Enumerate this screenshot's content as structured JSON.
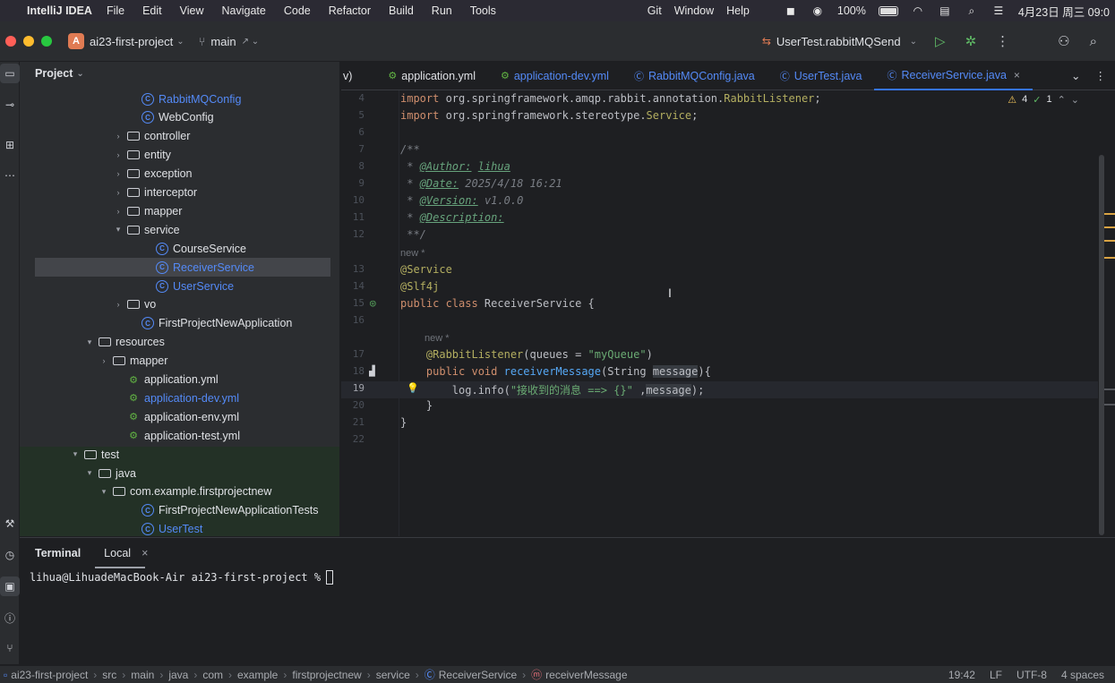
{
  "menubar": {
    "app_name": "IntelliJ IDEA",
    "items": [
      "File",
      "Edit",
      "View",
      "Navigate",
      "Code",
      "Refactor",
      "Build",
      "Run",
      "Tools"
    ],
    "right_items": [
      "Git",
      "Window",
      "Help"
    ],
    "battery": "100%",
    "clock": "4月23日 周三 09:0"
  },
  "titlebar": {
    "project_badge": "A",
    "project_name": "ai23-first-project",
    "branch": "main",
    "run_config": "UserTest.rabbitMQSend"
  },
  "project": {
    "title": "Project",
    "rows": [
      {
        "label": "RabbitMQConfig",
        "type": "class",
        "expandable": false,
        "color": "#548af7"
      },
      {
        "label": "WebConfig",
        "type": "class",
        "expandable": false
      },
      {
        "label": "controller",
        "type": "folder",
        "expandable": true
      },
      {
        "label": "entity",
        "type": "folder",
        "expandable": true
      },
      {
        "label": "exception",
        "type": "folder",
        "expandable": true
      },
      {
        "label": "interceptor",
        "type": "folder",
        "expandable": true
      },
      {
        "label": "mapper",
        "type": "folder",
        "expandable": true
      },
      {
        "label": "service",
        "type": "folder",
        "expandable": true,
        "expanded": true
      },
      {
        "label": "CourseService",
        "type": "class",
        "expandable": false
      },
      {
        "label": "ReceiverService",
        "type": "class",
        "expandable": false,
        "selected": true,
        "color": "#548af7"
      },
      {
        "label": "UserService",
        "type": "class",
        "expandable": false,
        "color": "#548af7"
      },
      {
        "label": "vo",
        "type": "folder",
        "expandable": true
      },
      {
        "label": "FirstProjectNewApplication",
        "type": "class",
        "expandable": false
      },
      {
        "label": "resources",
        "type": "folder",
        "expandable": true,
        "expanded": true
      },
      {
        "label": "mapper",
        "type": "folder",
        "expandable": true
      },
      {
        "label": "application.yml",
        "type": "yml",
        "expandable": false
      },
      {
        "label": "application-dev.yml",
        "type": "yml",
        "expandable": false,
        "color": "#548af7"
      },
      {
        "label": "application-env.yml",
        "type": "yml",
        "expandable": false
      },
      {
        "label": "application-test.yml",
        "type": "yml",
        "expandable": false
      },
      {
        "label": "test",
        "type": "folder",
        "expandable": true,
        "expanded": true
      },
      {
        "label": "java",
        "type": "folder",
        "expandable": true,
        "expanded": true
      },
      {
        "label": "com.example.firstprojectnew",
        "type": "folder",
        "expandable": true,
        "expanded": true
      },
      {
        "label": "FirstProjectNewApplicationTests",
        "type": "class",
        "expandable": false
      },
      {
        "label": "UserTest",
        "type": "class",
        "expandable": false,
        "color": "#548af7"
      }
    ]
  },
  "tabs": [
    {
      "label": "v)",
      "icon": "",
      "active": false
    },
    {
      "label": "application.yml",
      "icon": "yml-icon",
      "active": false
    },
    {
      "label": "application-dev.yml",
      "icon": "yml-icon",
      "active": false,
      "color": "#548af7"
    },
    {
      "label": "RabbitMQConfig.java",
      "icon": "class-icon",
      "active": false,
      "color": "#548af7"
    },
    {
      "label": "UserTest.java",
      "icon": "class-icon",
      "active": false,
      "color": "#548af7"
    },
    {
      "label": "ReceiverService.java",
      "icon": "class-icon",
      "active": true,
      "color": "#548af7"
    }
  ],
  "inspection": {
    "warnings": "4",
    "checks": "1"
  },
  "editor": {
    "hint_new": "new *",
    "lines": [
      {
        "num": "4",
        "html": "<span class=\"kw\">import</span> org.springframework.amqp.rabbit.annotation.<span class=\"ann\">RabbitListener</span>;"
      },
      {
        "num": "5",
        "html": "<span class=\"kw\">import</span> org.springframework.stereotype.<span class=\"ann\">Service</span>;"
      },
      {
        "num": "6",
        "html": ""
      },
      {
        "num": "7",
        "html": "<span class=\"cm\">/**</span>"
      },
      {
        "num": "8",
        "html": "<span class=\"cm\"> * <span class=\"tag\">@Author:</span> <span class=\"tag\">lihua</span></span>"
      },
      {
        "num": "9",
        "html": "<span class=\"cm\"> * <span class=\"tag\">@Date:</span> 2025/4/18 16:21</span>"
      },
      {
        "num": "10",
        "html": "<span class=\"cm\"> * <span class=\"tag\">@Version:</span> v1.0.0</span>"
      },
      {
        "num": "11",
        "html": "<span class=\"cm\"> * <span class=\"tag\">@Description:</span></span>"
      },
      {
        "num": "12",
        "html": "<span class=\"cm\"> **/</span>"
      },
      {
        "num": "13",
        "html": "<span class=\"ann\">@Service</span>"
      },
      {
        "num": "14",
        "html": "<span class=\"ann\">@Slf4j</span>"
      },
      {
        "num": "15",
        "html": "<span class=\"kw\">public class</span> ReceiverService {"
      },
      {
        "num": "16",
        "html": ""
      },
      {
        "num": "17",
        "html": "    <span class=\"ann\">@RabbitListener</span>(queues = <span class=\"str\">\"myQueue\"</span>)"
      },
      {
        "num": "18",
        "html": "    <span class=\"kw\">public void</span> <span class=\"fn\">receiverMessage</span>(String <span class=\"hl\">message</span>){"
      },
      {
        "num": "19",
        "html": "        log.info(<span class=\"str\">\"接收到的消息 ==> {}\"</span> ,<span class=\"hl\">message</span>);"
      },
      {
        "num": "20",
        "html": "    }"
      },
      {
        "num": "21",
        "html": "}"
      },
      {
        "num": "22",
        "html": ""
      }
    ]
  },
  "terminal": {
    "title": "Terminal",
    "tab": "Local",
    "prompt": "lihua@LihuadeMacBook-Air ai23-first-project % "
  },
  "statusbar": {
    "breadcrumbs": [
      "ai23-first-project",
      "src",
      "main",
      "java",
      "com",
      "example",
      "firstprojectnew",
      "service",
      "ReceiverService",
      "receiverMessage"
    ],
    "position": "19:42",
    "line_sep": "LF",
    "encoding": "UTF-8",
    "indent": "4 spaces"
  },
  "colors": {
    "accent": "#3574f0",
    "class_blue": "#548af7",
    "test_green": "#233126"
  }
}
